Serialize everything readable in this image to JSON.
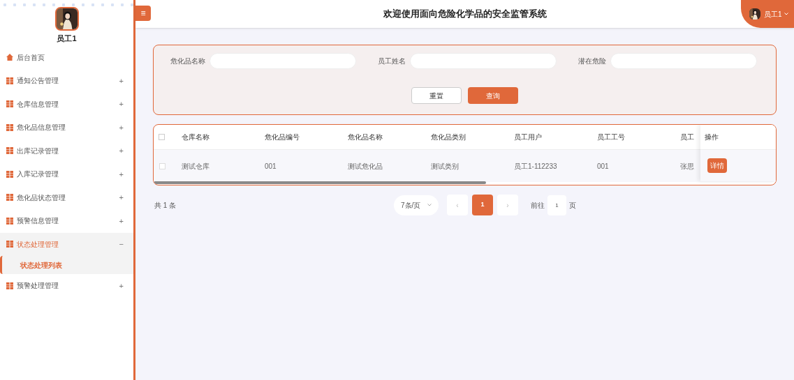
{
  "sidebar": {
    "username": "员工1",
    "items": [
      {
        "label": "后台首页",
        "kind": "home"
      },
      {
        "label": "通知公告管理",
        "kind": "group",
        "expanded": false,
        "toggle": "+"
      },
      {
        "label": "仓库信息管理",
        "kind": "group",
        "expanded": false,
        "toggle": "+"
      },
      {
        "label": "危化品信息管理",
        "kind": "group",
        "expanded": false,
        "toggle": "+"
      },
      {
        "label": "出库记录管理",
        "kind": "group",
        "expanded": false,
        "toggle": "+"
      },
      {
        "label": "入库记录管理",
        "kind": "group",
        "expanded": false,
        "toggle": "+"
      },
      {
        "label": "危化品状态管理",
        "kind": "group",
        "expanded": false,
        "toggle": "+"
      },
      {
        "label": "预警信息管理",
        "kind": "group",
        "expanded": false,
        "toggle": "+"
      },
      {
        "label": "状态处理管理",
        "kind": "group",
        "expanded": true,
        "toggle": "−",
        "children": [
          {
            "label": "状态处理列表",
            "selected": true
          }
        ]
      },
      {
        "label": "预警处理管理",
        "kind": "group",
        "expanded": false,
        "toggle": "+"
      }
    ]
  },
  "header": {
    "menu_icon": "≡",
    "title": "欢迎使用面向危险化学品的安全监管系统",
    "user": "员工1"
  },
  "search": {
    "fields": [
      {
        "label": "危化品名称"
      },
      {
        "label": "员工姓名"
      },
      {
        "label": "潜在危险"
      }
    ],
    "buttons": [
      {
        "label": "重置",
        "kind": "plain"
      },
      {
        "label": "查询",
        "kind": "primary"
      }
    ]
  },
  "table": {
    "header_checked": false,
    "columns": [
      "仓库名称",
      "危化品编号",
      "危化品名称",
      "危化品类别",
      "员工用户",
      "员工工号",
      "员工"
    ],
    "action_column": "操作",
    "rows": [
      {
        "checked": false,
        "cells": [
          "测试仓库",
          "001",
          "测试危化品",
          "测试类别",
          "员工1-112233",
          "001",
          "张思"
        ],
        "action": "详情"
      }
    ]
  },
  "pagination": {
    "total": "共 1 条",
    "page_size": "7条/页",
    "prev": "‹",
    "pages": [
      {
        "label": "1",
        "selected": true
      }
    ],
    "next": "›",
    "goto_label": "前往",
    "goto_value": "1",
    "goto_suffix": "页"
  }
}
